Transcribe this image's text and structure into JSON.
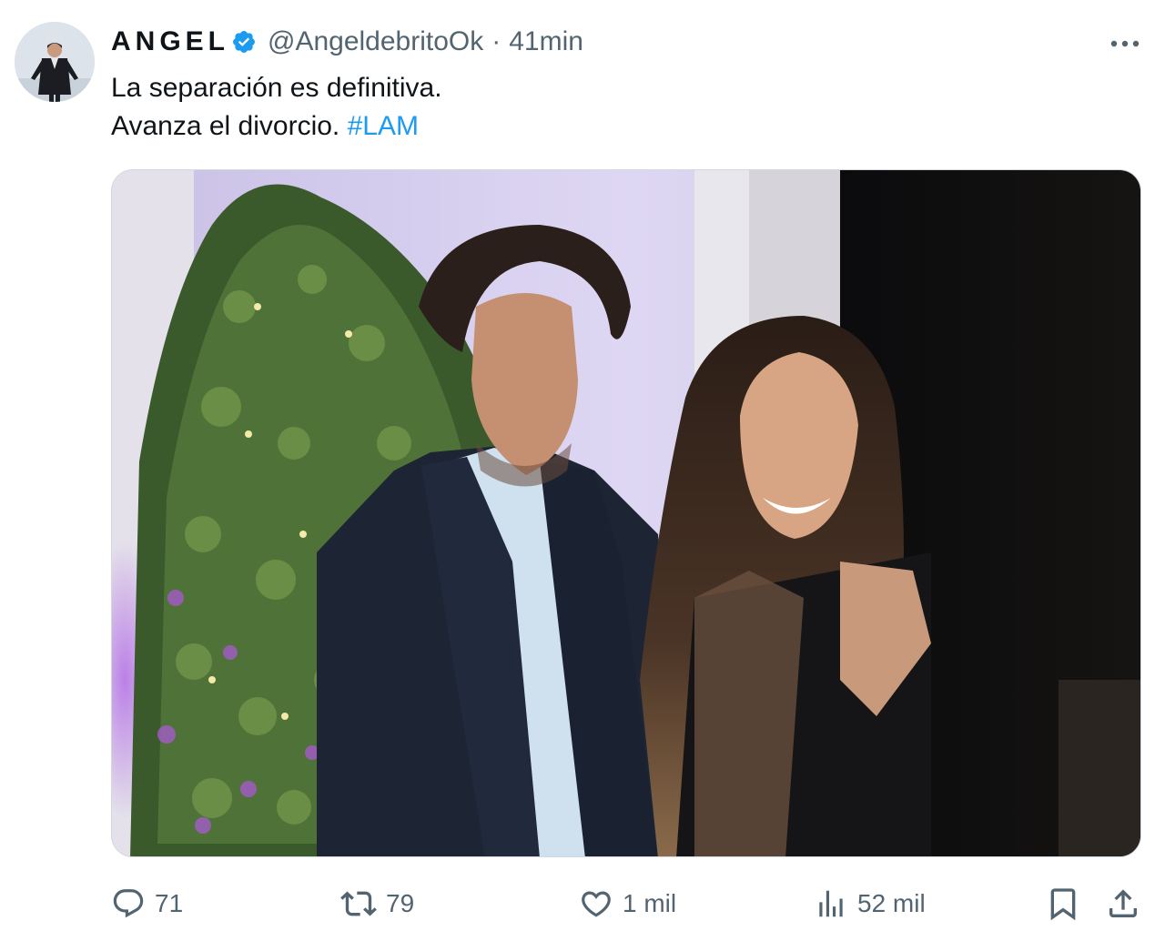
{
  "tweet": {
    "author": {
      "display_name": "ANGEL",
      "handle": "@AngeldebritoOk",
      "verified": true
    },
    "separator": "·",
    "time": "41min",
    "text_lines": [
      "La separación es definitiva.",
      "Avanza el divorcio. "
    ],
    "hashtag": "#LAM"
  },
  "actions": {
    "replies": "71",
    "retweets": "79",
    "likes": "1 mil",
    "views": "52 mil"
  },
  "icons": {
    "verified": "verified-badge-icon",
    "more": "more-options-icon",
    "reply": "reply-icon",
    "retweet": "retweet-icon",
    "like": "like-icon",
    "views": "views-icon",
    "bookmark": "bookmark-icon",
    "share": "share-icon"
  },
  "colors": {
    "accent": "#1d9bf0",
    "text": "#0f1419",
    "muted": "#536471"
  }
}
